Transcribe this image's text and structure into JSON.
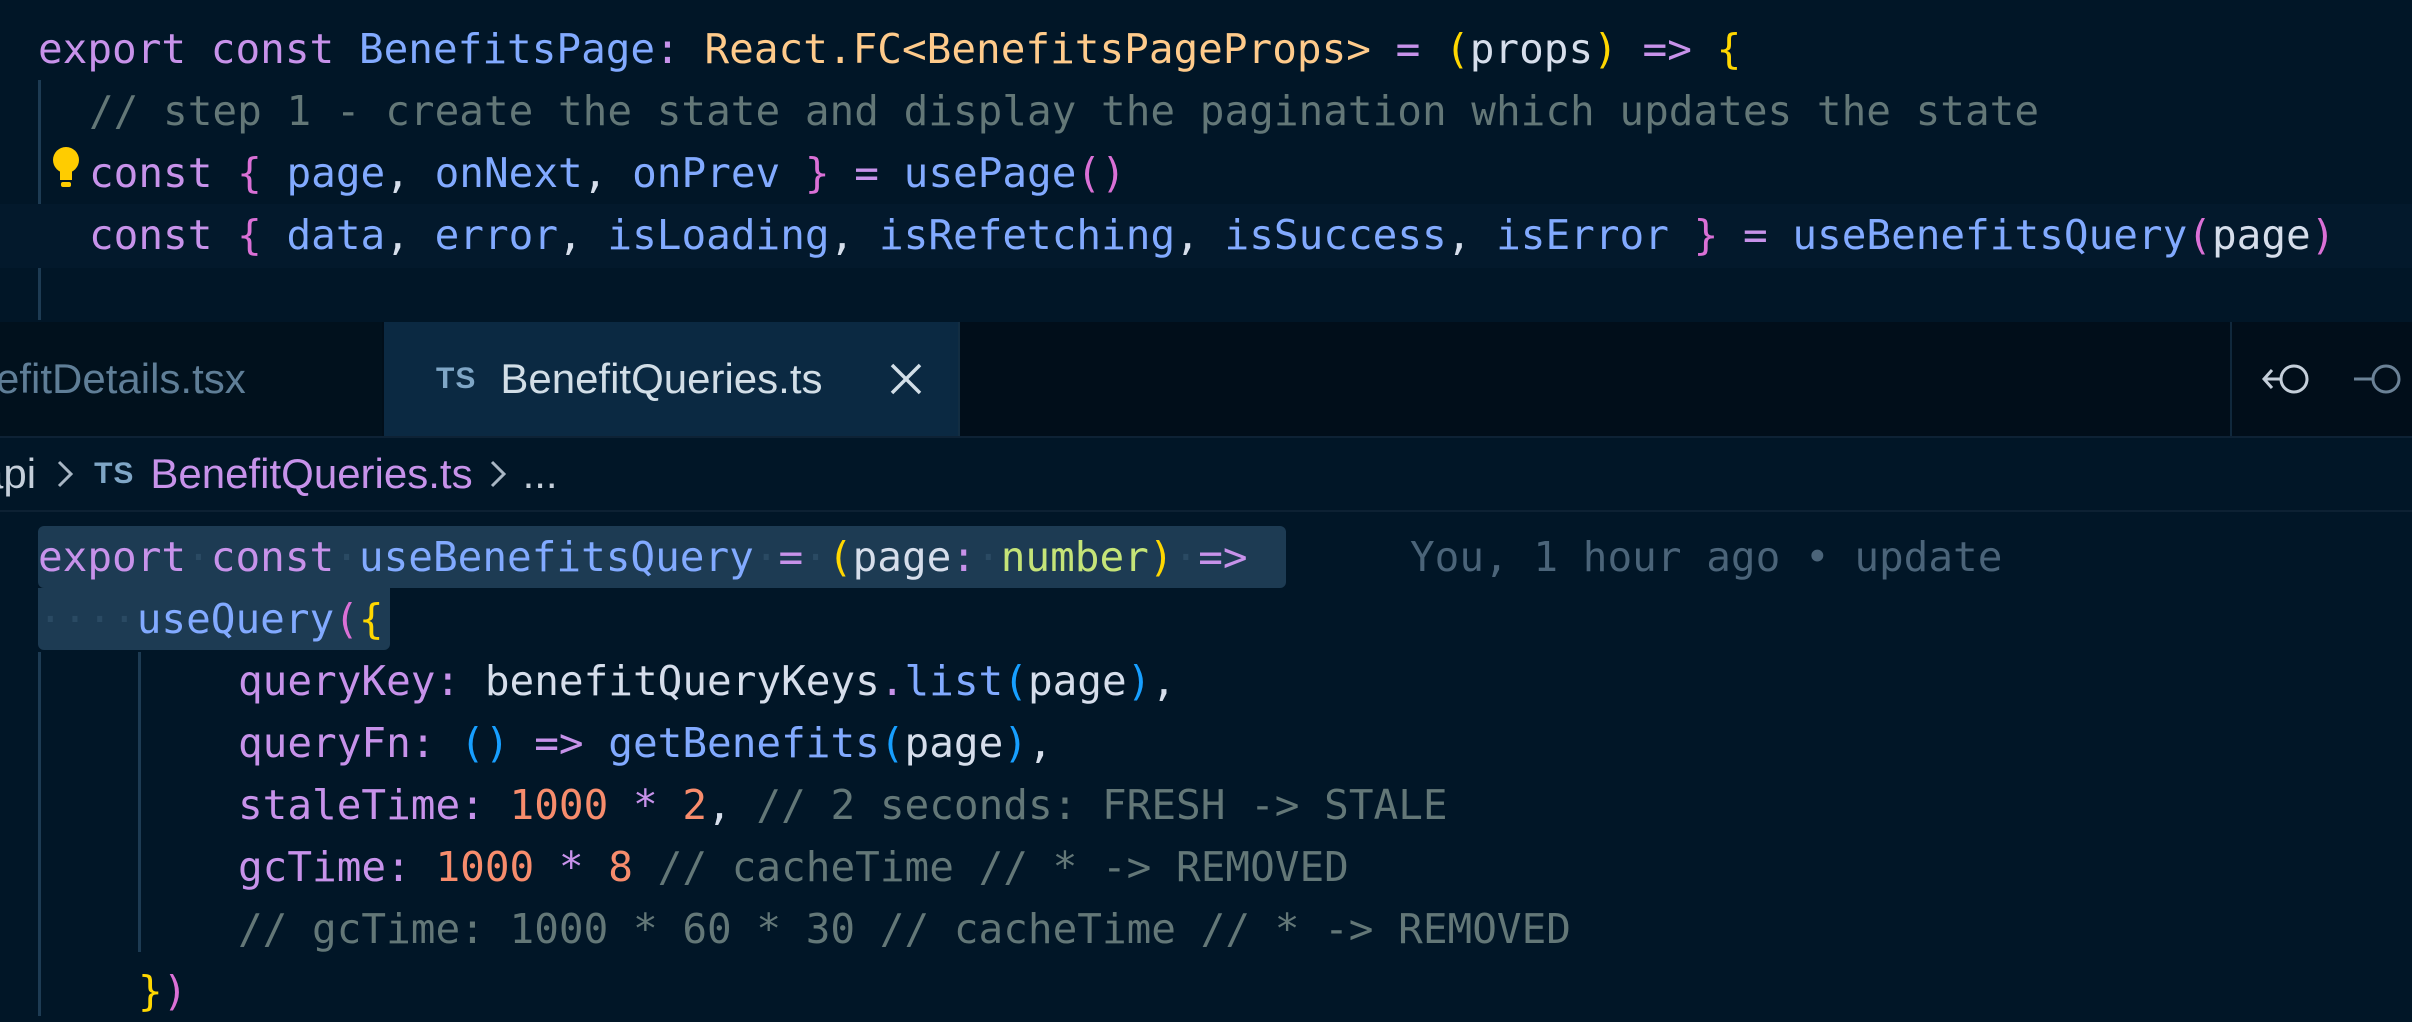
{
  "top_editor": {
    "lines": [
      "export const BenefitsPage: React.FC<BenefitsPageProps> = (props) => {",
      "// step 1 - create the state and display the pagination which updates the state",
      "const { page, onNext, onPrev } = usePage()",
      "const { data, error, isLoading, isRefetching, isSuccess, isError } = useBenefitsQuery(page)"
    ]
  },
  "tabs": [
    {
      "label": "efitDetails.tsx",
      "active": false
    },
    {
      "label": "BenefitQueries.ts",
      "badge": "TS",
      "active": true
    }
  ],
  "breadcrumb": {
    "folder": "api",
    "file_badge": "TS",
    "file": "BenefitQueries.ts",
    "tail": "..."
  },
  "bottom_editor": {
    "blame": "You, 1 hour ago • update",
    "lines": [
      "export const useBenefitsQuery = (page: number) =>",
      "useQuery({",
      "queryKey: benefitQueryKeys.list(page),",
      "queryFn: () => getBenefits(page),",
      "staleTime: 1000 * 2, // 2 seconds: FRESH -> STALE",
      "gcTime: 1000 * 8 // cacheTime // * -> REMOVED",
      "// gcTime: 1000 * 60 * 30 // cacheTime // * -> REMOVED",
      "})"
    ]
  },
  "colors": {
    "background": "#011627",
    "keyword": "#c792ea",
    "function": "#82aaff",
    "comment": "#637777",
    "number": "#f78c6c",
    "lightbulb": "#ffcc00"
  },
  "icons": [
    "lightbulb-icon",
    "close-icon",
    "go-back-icon",
    "go-forward-icon",
    "chevron-right-icon"
  ]
}
